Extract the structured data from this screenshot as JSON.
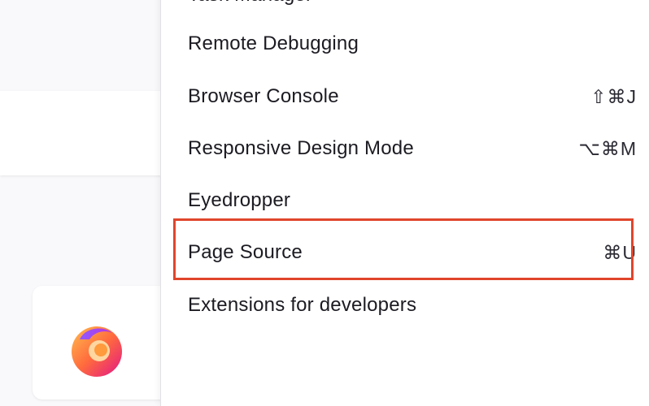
{
  "menu": {
    "partial_item_label": "Task Manager",
    "items": [
      {
        "label": "Remote Debugging",
        "shortcut": ""
      },
      {
        "label": "Browser Console",
        "shortcut": "⇧⌘J"
      },
      {
        "label": "Responsive Design Mode",
        "shortcut": "⌥⌘M"
      },
      {
        "label": "Eyedropper",
        "shortcut": ""
      },
      {
        "label": "Page Source",
        "shortcut": "⌘U"
      },
      {
        "label": "Extensions for developers",
        "shortcut": ""
      }
    ]
  },
  "highlight": {
    "target": "Page Source",
    "color": "#e0452c"
  },
  "icons": {
    "background_tile_icon": "firefox-logo-icon"
  }
}
